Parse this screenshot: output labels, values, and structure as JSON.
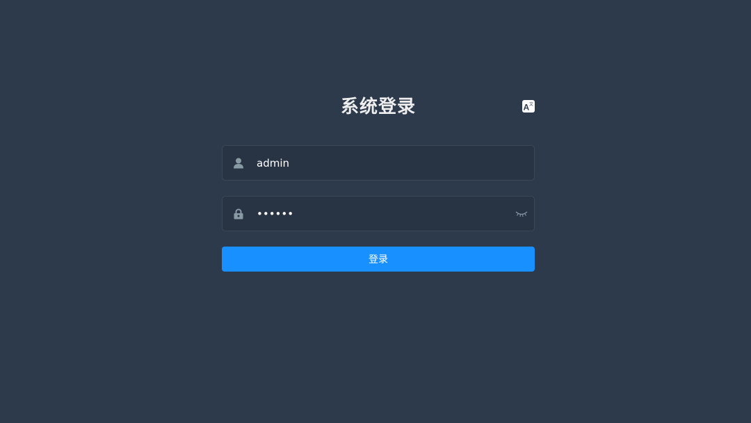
{
  "login": {
    "title": "系统登录",
    "username": {
      "value": "admin",
      "icon": "user-icon"
    },
    "password": {
      "value": "••••••",
      "icon": "lock-icon",
      "toggle_icon": "eye-closed-icon"
    },
    "submit_label": "登录",
    "lang_icon": "translate-icon"
  },
  "colors": {
    "background": "#2d3a4b",
    "input_background": "#283443",
    "accent": "#1890ff",
    "icon": "#889aa4",
    "title": "#eeeeee"
  }
}
